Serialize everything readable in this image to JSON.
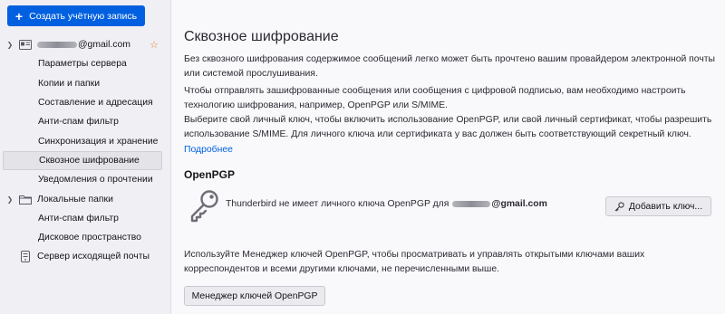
{
  "sidebar": {
    "create_button_label": "Создать учётную запись",
    "account": {
      "email_suffix": "@gmail.com",
      "items": [
        {
          "label": "Параметры сервера"
        },
        {
          "label": "Копии и папки"
        },
        {
          "label": "Составление и адресация"
        },
        {
          "label": "Анти-спам фильтр"
        },
        {
          "label": "Синхронизация и хранение"
        },
        {
          "label": "Сквозное шифрование"
        },
        {
          "label": "Уведомления о прочтении"
        }
      ]
    },
    "local_folders": {
      "label": "Локальные папки",
      "items": [
        {
          "label": "Анти-спам фильтр"
        },
        {
          "label": "Дисковое пространство"
        }
      ]
    },
    "outgoing_server_label": "Сервер исходящей почты"
  },
  "main": {
    "title": "Сквозное шифрование",
    "para1": "Без сквозного шифрования содержимое сообщений легко может быть прочтено вашим провайдером электронной почты или системой прослушивания.",
    "para2": "Чтобы отправлять зашифрованные сообщения или сообщения с цифровой подписью, вам необходимо настроить технологию шифрования, например, OpenPGP или S/MIME.",
    "para3": "Выберите свой личный ключ, чтобы включить использование OpenPGP, или свой личный сертификат, чтобы разрешить использование S/MIME. Для личного ключа или сертификата у вас должен быть соответствующий секретный ключ.",
    "more_link": "Подробнее",
    "openpgp": {
      "section_title": "OpenPGP",
      "no_key_text": "Thunderbird не имеет личного ключа OpenPGP для",
      "email_suffix": "@gmail.com",
      "add_key_button": "Добавить ключ...",
      "manager_text": "Используйте Менеджер ключей OpenPGP, чтобы просматривать и управлять открытыми ключами ваших корреспондентов и всеми другими ключами, не перечисленными выше.",
      "manager_button": "Менеджер ключей OpenPGP"
    }
  },
  "colors": {
    "accent": "#0060df",
    "link": "#0061e0",
    "star": "#e27f2e"
  }
}
